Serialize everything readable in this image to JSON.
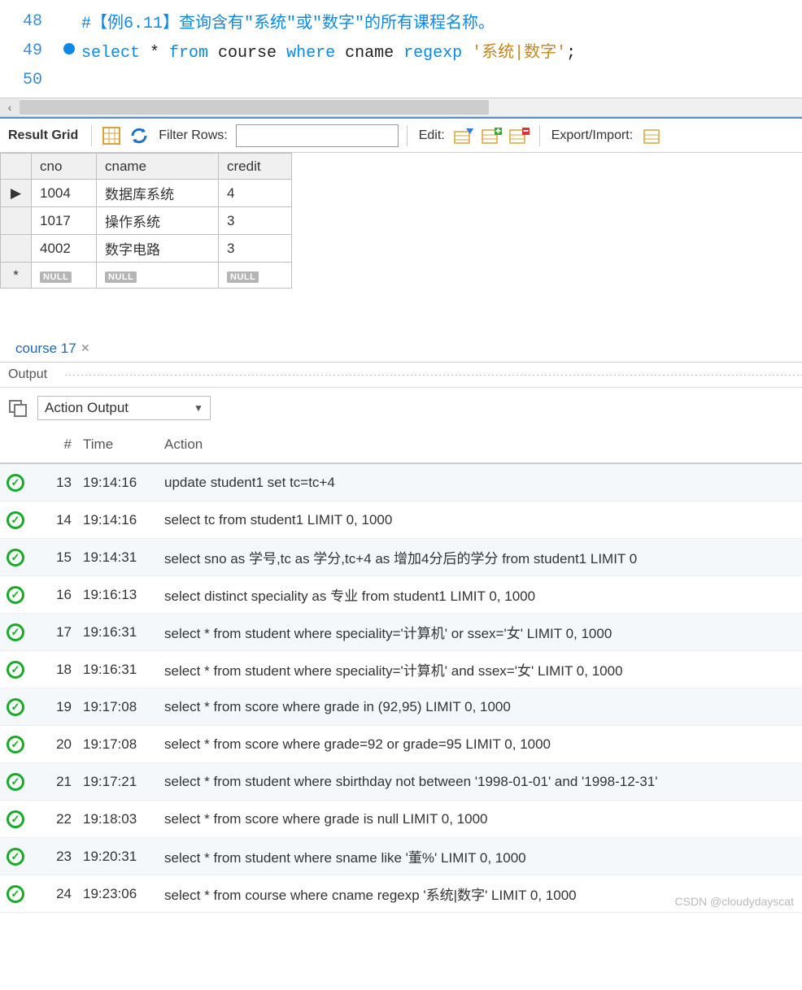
{
  "editor": {
    "lines": [
      {
        "num": "48",
        "marker": false,
        "segments": [
          {
            "cls": "c-comment",
            "text": "#【例6.11】查询含有\"系统\"或\"数字\"的所有课程名称。"
          }
        ]
      },
      {
        "num": "49",
        "marker": true,
        "segments": [
          {
            "cls": "c-keyword",
            "text": "select"
          },
          {
            "cls": "c-plain",
            "text": " * "
          },
          {
            "cls": "c-keyword",
            "text": "from"
          },
          {
            "cls": "c-plain",
            "text": " course "
          },
          {
            "cls": "c-keyword",
            "text": "where"
          },
          {
            "cls": "c-plain",
            "text": " cname "
          },
          {
            "cls": "c-keyword",
            "text": "regexp"
          },
          {
            "cls": "c-plain",
            "text": " "
          },
          {
            "cls": "c-string",
            "text": "'系统|数字'"
          },
          {
            "cls": "c-plain",
            "text": ";"
          }
        ]
      },
      {
        "num": "50",
        "marker": false,
        "segments": []
      }
    ]
  },
  "toolbar": {
    "result_grid": "Result Grid",
    "filter_rows": "Filter Rows:",
    "filter_value": "",
    "edit": "Edit:",
    "export_import": "Export/Import:"
  },
  "grid": {
    "headers": [
      "cno",
      "cname",
      "credit"
    ],
    "rows": [
      {
        "ptr": "▶",
        "cno": "1004",
        "cname": "数据库系统",
        "credit": "4"
      },
      {
        "ptr": "",
        "cno": "1017",
        "cname": "操作系统",
        "credit": "3"
      },
      {
        "ptr": "",
        "cno": "4002",
        "cname": "数字电路",
        "credit": "3"
      }
    ],
    "null_label": "NULL",
    "newrow_marker": "*"
  },
  "tabs": {
    "active": "course 17"
  },
  "output": {
    "title": "Output",
    "dropdown": "Action Output",
    "cols": {
      "num": "#",
      "time": "Time",
      "action": "Action"
    },
    "rows": [
      {
        "n": "13",
        "t": "19:14:16",
        "a": "update student1 set tc=tc+4"
      },
      {
        "n": "14",
        "t": "19:14:16",
        "a": "select tc from student1 LIMIT 0, 1000"
      },
      {
        "n": "15",
        "t": "19:14:31",
        "a": "select sno as 学号,tc as 学分,tc+4 as 增加4分后的学分 from student1 LIMIT 0"
      },
      {
        "n": "16",
        "t": "19:16:13",
        "a": "select distinct speciality as 专业 from student1 LIMIT 0, 1000"
      },
      {
        "n": "17",
        "t": "19:16:31",
        "a": "select * from student where speciality='计算机' or ssex='女' LIMIT 0, 1000"
      },
      {
        "n": "18",
        "t": "19:16:31",
        "a": "select * from student where speciality='计算机' and ssex='女' LIMIT 0, 1000"
      },
      {
        "n": "19",
        "t": "19:17:08",
        "a": "select * from score where grade in (92,95) LIMIT 0, 1000"
      },
      {
        "n": "20",
        "t": "19:17:08",
        "a": "select * from score where grade=92 or grade=95 LIMIT 0, 1000"
      },
      {
        "n": "21",
        "t": "19:17:21",
        "a": "select * from student where sbirthday not between '1998-01-01' and '1998-12-31'"
      },
      {
        "n": "22",
        "t": "19:18:03",
        "a": "select * from score where grade is null LIMIT 0, 1000"
      },
      {
        "n": "23",
        "t": "19:20:31",
        "a": "select * from student where sname like '董%' LIMIT 0, 1000"
      },
      {
        "n": "24",
        "t": "19:23:06",
        "a": "select * from course where cname regexp '系统|数字' LIMIT 0, 1000"
      }
    ]
  },
  "watermark": "CSDN @cloudydayscat"
}
